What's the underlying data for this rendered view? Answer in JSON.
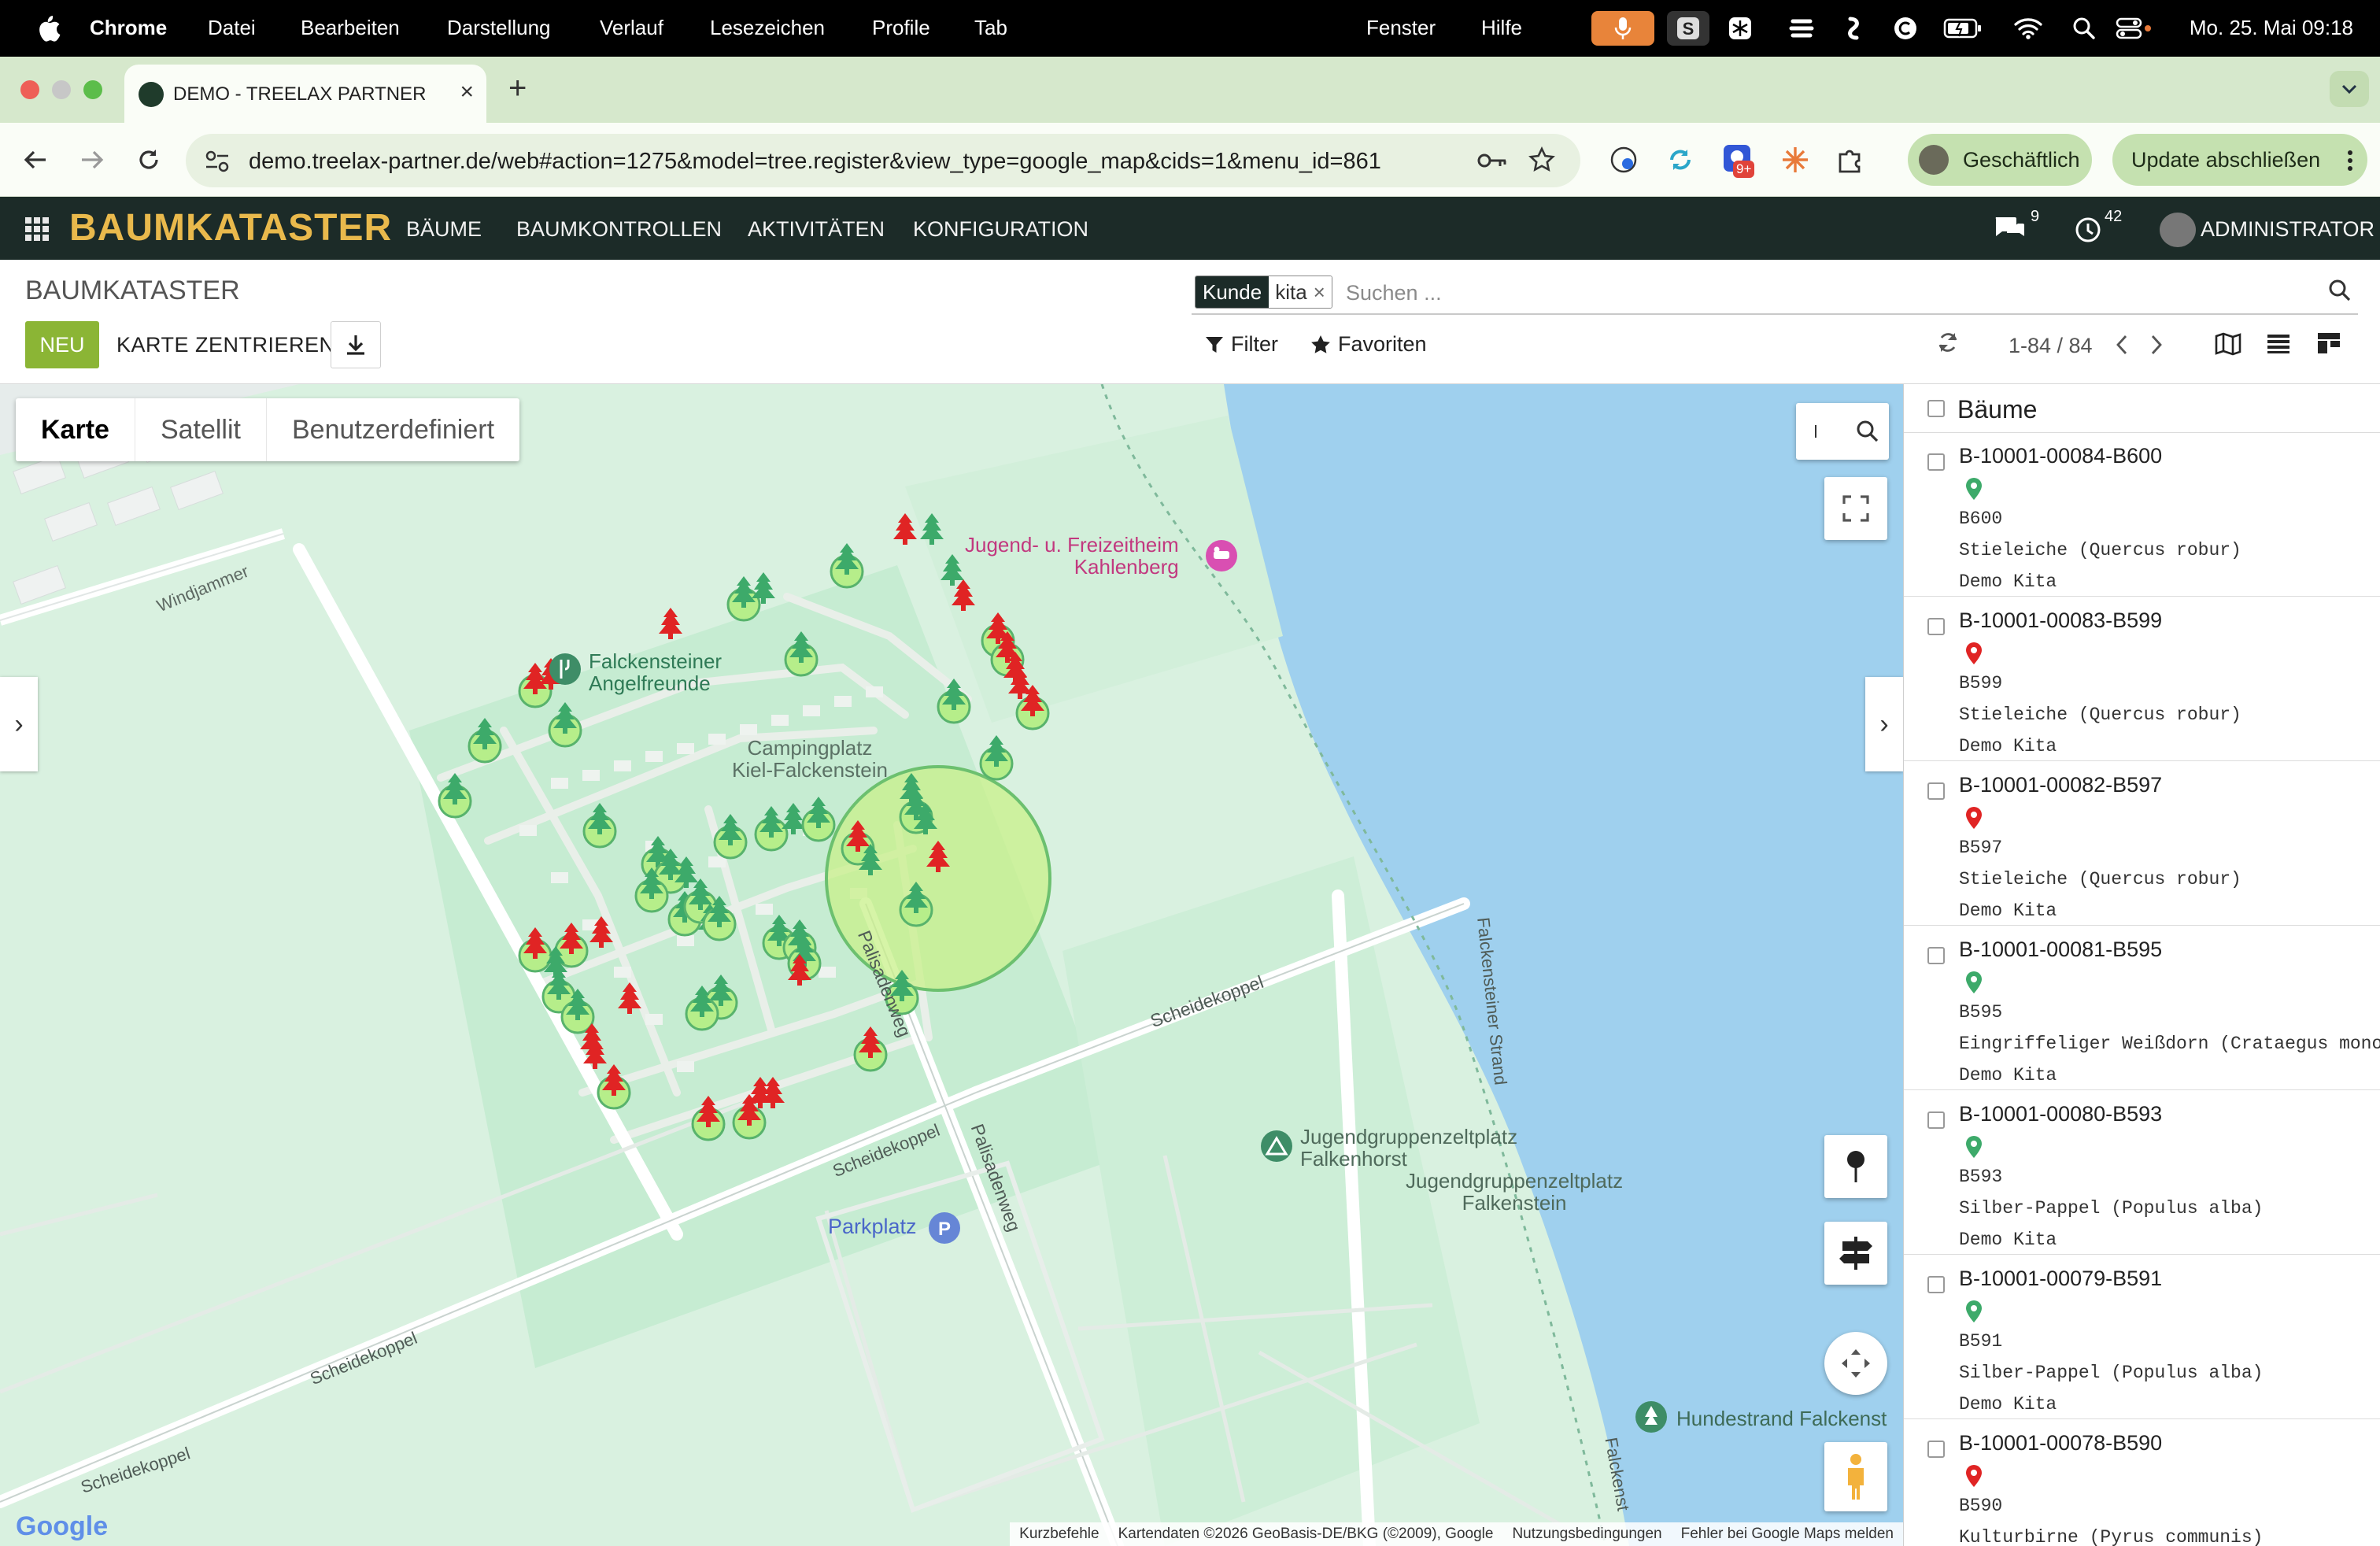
{
  "macos_menubar": {
    "app_name": "Chrome",
    "menus": [
      "Datei",
      "Bearbeiten",
      "Darstellung",
      "Verlauf",
      "Lesezeichen",
      "Profile",
      "Tab",
      "Fenster",
      "Hilfe"
    ],
    "clock": "Mo. 25. Mai  09:18"
  },
  "browser": {
    "tab_title": "DEMO - TREELAX PARTNER -",
    "url": "demo.treelax-partner.de/web#action=1275&model=tree.register&view_type=google_map&cids=1&menu_id=861",
    "extension_badge": "9+",
    "profile_label": "Geschäftlich",
    "update_label": "Update abschließen"
  },
  "app_nav": {
    "brand": "BAUMKATASTER",
    "menu": [
      "BÄUME",
      "BAUMKONTROLLEN",
      "AKTIVITÄTEN",
      "KONFIGURATION"
    ],
    "messages_count": "9",
    "activities_count": "42",
    "user": "ADMINISTRATOR"
  },
  "control_panel": {
    "title": "BAUMKATASTER",
    "facet_key": "Kunde",
    "facet_value": "kita",
    "facet_remove": "×",
    "search_placeholder": "Suchen ...",
    "new_button": "NEU",
    "center_button": "KARTE ZENTRIEREN",
    "filter_label": "Filter",
    "favorites_label": "Favoriten",
    "pager": "1-84 / 84"
  },
  "map": {
    "type_buttons": [
      "Karte",
      "Satellit",
      "Benutzerdefiniert"
    ],
    "active_type": "Karte",
    "labels": {
      "youth_center": "Jugend- u. Freizeitheim\nKahlenberg",
      "anglers": "Falckensteiner\nAngelfreunde",
      "campground": "Campingplatz\nKiel-Falckenstein",
      "tent_falkenhorst": "Jugendgruppenzeltplatz\nFalkenhorst",
      "tent_falkenstein": "Jugendgruppenzeltplatz\nFalkenstein",
      "parking": "Parkplatz",
      "beach": "Hundestrand Falckenst",
      "street_windjammer": "Windjammer",
      "street_scheidekoppel": "Scheidekoppel",
      "street_palisadenweg": "Palisadenweg",
      "street_strand": "Falckensteiner Strand",
      "street_falcken": "Falckenst"
    },
    "google_logo": "Google",
    "attribution": [
      "Kurzbefehle",
      "Kartendaten ©2026 GeoBasis-DE/BKG (©2009), Google",
      "Nutzungsbedingungen",
      "Fehler bei Google Maps melden"
    ],
    "colors": {
      "tree_green": "#3daa6a",
      "tree_red": "#e02424",
      "buffer": "#c8f08a",
      "water": "#9fd0ee",
      "land": "#d9f1e0"
    }
  },
  "tree_list": {
    "header": "Bäume",
    "records": [
      {
        "code": "B-10001-00084-B600",
        "status": "green",
        "number": "B600",
        "species": "Stieleiche (Quercus robur)",
        "customer": "Demo Kita"
      },
      {
        "code": "B-10001-00083-B599",
        "status": "red",
        "number": "B599",
        "species": "Stieleiche (Quercus robur)",
        "customer": "Demo Kita"
      },
      {
        "code": "B-10001-00082-B597",
        "status": "red",
        "number": "B597",
        "species": "Stieleiche (Quercus robur)",
        "customer": "Demo Kita"
      },
      {
        "code": "B-10001-00081-B595",
        "status": "green",
        "number": "B595",
        "species": "Eingriffeliger Weißdorn (Crataegus monog",
        "customer": "Demo Kita"
      },
      {
        "code": "B-10001-00080-B593",
        "status": "green",
        "number": "B593",
        "species": "Silber-Pappel (Populus alba)",
        "customer": "Demo Kita"
      },
      {
        "code": "B-10001-00079-B591",
        "status": "green",
        "number": "B591",
        "species": "Silber-Pappel (Populus alba)",
        "customer": "Demo Kita"
      },
      {
        "code": "B-10001-00078-B590",
        "status": "red",
        "number": "B590",
        "species": "Kulturbirne (Pyrus communis)",
        "customer": ""
      }
    ]
  }
}
